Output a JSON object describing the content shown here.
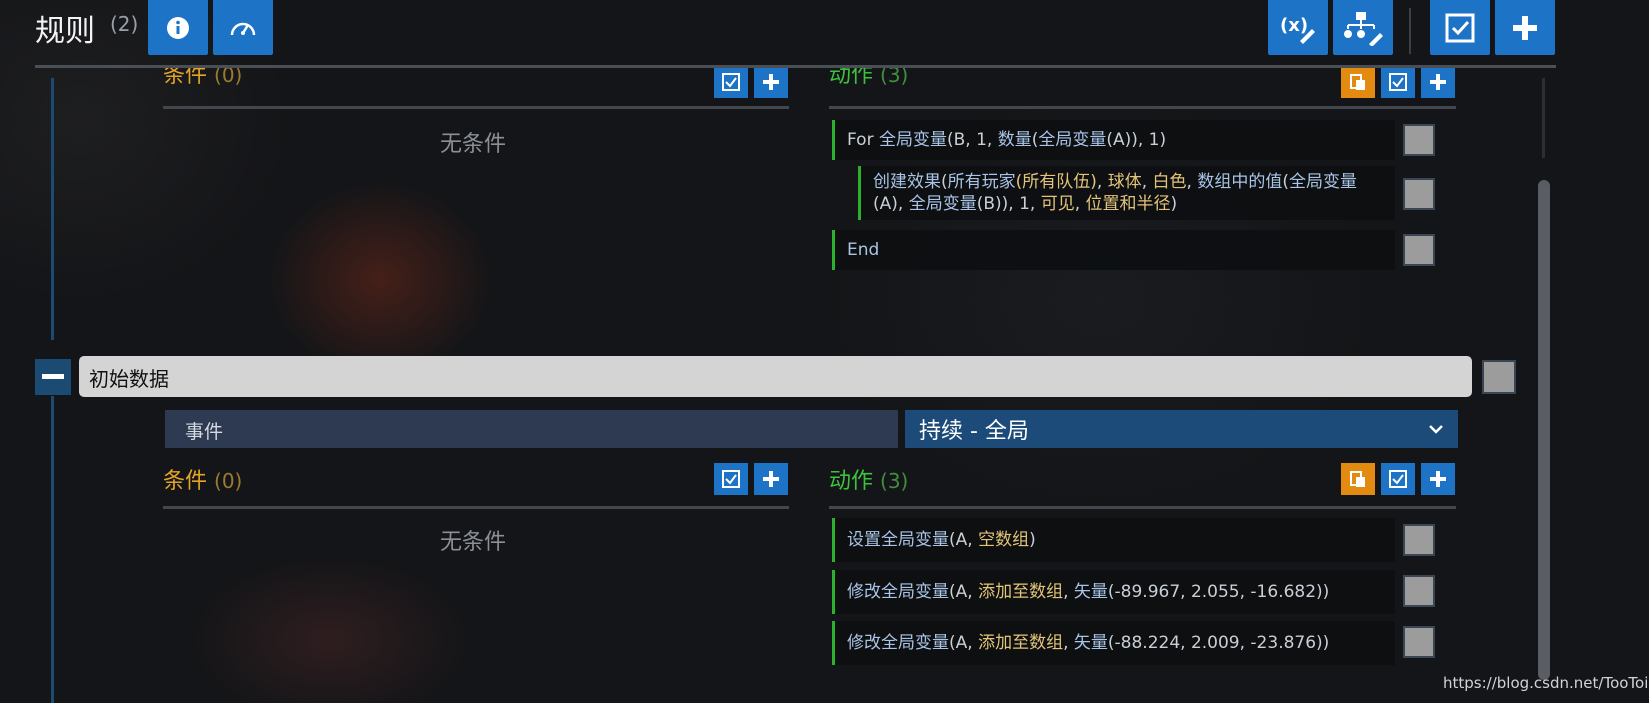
{
  "header": {
    "title": "规则",
    "count": "(2)",
    "icons": [
      "info-icon",
      "speedometer-icon",
      "variable-edit-icon",
      "hierarchy-edit-icon",
      "checkbox-icon",
      "plus-icon"
    ]
  },
  "rule1": {
    "conditions": {
      "label": "条件",
      "count": "(0)",
      "empty_text": "无条件"
    },
    "actions": {
      "label": "动作",
      "count": "(3)",
      "items": [
        {
          "parts": [
            {
              "t": "For ",
              "c": "w"
            },
            {
              "t": "全局变量",
              "c": "b"
            },
            {
              "t": "(B, 1, ",
              "c": "w"
            },
            {
              "t": "数量",
              "c": "b"
            },
            {
              "t": "(",
              "c": "w"
            },
            {
              "t": "全局变量",
              "c": "b"
            },
            {
              "t": "(A)), 1)",
              "c": "w"
            }
          ]
        },
        {
          "parts": [
            {
              "t": "创建效果",
              "c": "b"
            },
            {
              "t": "(",
              "c": "w"
            },
            {
              "t": "所有玩家",
              "c": "b"
            },
            {
              "t": "(所有队伍)",
              "c": "y"
            },
            {
              "t": ", ",
              "c": "w"
            },
            {
              "t": "球体",
              "c": "y"
            },
            {
              "t": ", ",
              "c": "w"
            },
            {
              "t": "白色",
              "c": "y"
            },
            {
              "t": ", ",
              "c": "w"
            },
            {
              "t": "数组中的值",
              "c": "b"
            },
            {
              "t": "(",
              "c": "w"
            },
            {
              "t": "全局变量",
              "c": "b"
            },
            {
              "t": "(A), ",
              "c": "w"
            },
            {
              "t": "全局变量",
              "c": "b"
            },
            {
              "t": "(B)), 1, ",
              "c": "w"
            },
            {
              "t": "可见",
              "c": "y"
            },
            {
              "t": ", ",
              "c": "w"
            },
            {
              "t": "位置和半径",
              "c": "y"
            },
            {
              "t": ")",
              "c": "w"
            }
          ]
        },
        {
          "parts": [
            {
              "t": "End",
              "c": "b"
            }
          ]
        }
      ]
    }
  },
  "rule2": {
    "name": "初始数据",
    "event_label": "事件",
    "event_value": "持续 - 全局",
    "conditions": {
      "label": "条件",
      "count": "(0)",
      "empty_text": "无条件"
    },
    "actions": {
      "label": "动作",
      "count": "(3)",
      "items": [
        {
          "parts": [
            {
              "t": "设置全局变量",
              "c": "b"
            },
            {
              "t": "(A, ",
              "c": "w"
            },
            {
              "t": "空数组",
              "c": "y"
            },
            {
              "t": ")",
              "c": "w"
            }
          ]
        },
        {
          "parts": [
            {
              "t": "修改全局变量",
              "c": "b"
            },
            {
              "t": "(A, ",
              "c": "w"
            },
            {
              "t": "添加至数组",
              "c": "y"
            },
            {
              "t": ", ",
              "c": "w"
            },
            {
              "t": "矢量",
              "c": "b"
            },
            {
              "t": "(-89.967, 2.055, -16.682))",
              "c": "w"
            }
          ]
        },
        {
          "parts": [
            {
              "t": "修改全局变量",
              "c": "b"
            },
            {
              "t": "(A, ",
              "c": "w"
            },
            {
              "t": "添加至数组",
              "c": "y"
            },
            {
              "t": ", ",
              "c": "w"
            },
            {
              "t": "矢量",
              "c": "b"
            },
            {
              "t": "(-88.224, 2.009, -23.876))",
              "c": "w"
            }
          ]
        }
      ]
    }
  },
  "watermark": "https://blog.csdn.net/TooToi",
  "colors": {
    "accent_blue": "#1d73c5",
    "accent_orange": "#e38a10",
    "condition_gold": "#e5a426",
    "action_green": "#3ec23e"
  }
}
